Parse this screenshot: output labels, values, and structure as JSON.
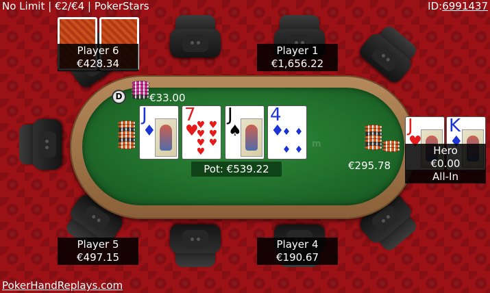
{
  "header": {
    "game_info": "No Limit | €2/€4 | PokerStars",
    "id_label": "ID:",
    "id_value": "6991437"
  },
  "footer": {
    "link_text": "PokerHandReplays.com"
  },
  "table": {
    "watermark": "m"
  },
  "pot": {
    "label": "Pot: €539.22"
  },
  "dealer_button": {
    "label": "D"
  },
  "bets": [
    {
      "seat": "player-6",
      "amount": "€33.00"
    },
    {
      "seat": "hero",
      "amount": "€295.78"
    }
  ],
  "players": [
    {
      "id": "player-6",
      "name": "Player 6",
      "stack": "€428.34",
      "cards": "face-down"
    },
    {
      "id": "player-1",
      "name": "Player 1",
      "stack": "€1,656.22"
    },
    {
      "id": "player-5",
      "name": "Player 5",
      "stack": "€497.15"
    },
    {
      "id": "player-4",
      "name": "Player 4",
      "stack": "€190.67"
    },
    {
      "id": "hero",
      "name": "Hero",
      "stack": "€0.00",
      "status": "All-In"
    }
  ],
  "board": [
    {
      "rank": "J",
      "suit": "♦",
      "color": "blue"
    },
    {
      "rank": "7",
      "suit": "♥",
      "color": "red"
    },
    {
      "rank": "J",
      "suit": "♠",
      "color": "black"
    },
    {
      "rank": "4",
      "suit": "♦",
      "color": "blue"
    }
  ],
  "hero_cards": [
    {
      "rank": "J",
      "suit": "♥",
      "color": "red"
    },
    {
      "rank": "K",
      "suit": "♦",
      "color": "blue"
    }
  ],
  "colors": {
    "background": "#9c1116",
    "felt": "#1f6c2a",
    "rail": "#a57a4e",
    "diamond_blue": "#1a34d6",
    "heart_red": "#e51b1b"
  }
}
